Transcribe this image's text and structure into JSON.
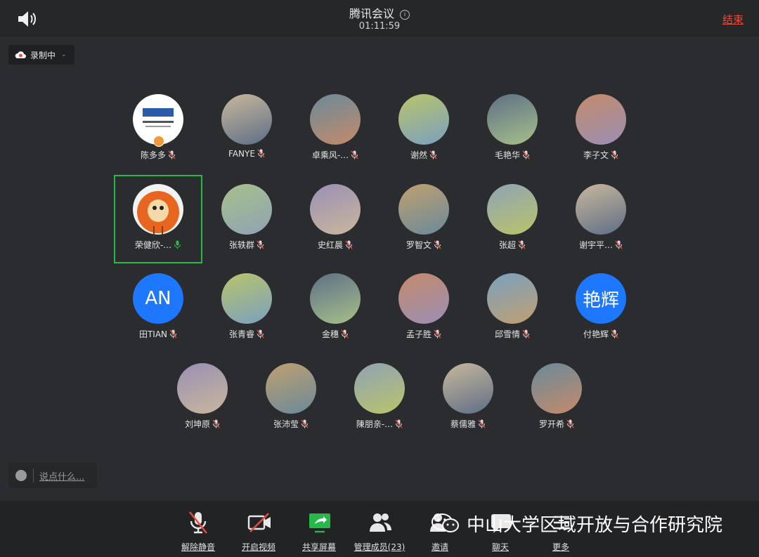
{
  "header": {
    "title": "腾讯会议",
    "info_glyph": "i",
    "timer": "01:11:59",
    "end_label": "结束"
  },
  "recording": {
    "label": "录制中",
    "chevron": "⌄"
  },
  "participants": [
    {
      "name": "陈多多",
      "muted": true,
      "avatar_icon": "logo-avatar",
      "host": true
    },
    {
      "name": "FANYE",
      "muted": true,
      "avatar_icon": "photo-avatar"
    },
    {
      "name": "卓乘风-…",
      "muted": true,
      "avatar_icon": "photo-avatar"
    },
    {
      "name": "谢然",
      "muted": true,
      "avatar_icon": "cartoon-avatar"
    },
    {
      "name": "毛艳华",
      "muted": true,
      "avatar_icon": "photo-avatar"
    },
    {
      "name": "李子文",
      "muted": true,
      "avatar_icon": "photo-avatar"
    },
    {
      "name": "荣健欣-…",
      "muted": false,
      "speaking": true,
      "avatar_icon": "cartoon-avatar"
    },
    {
      "name": "张轶群",
      "muted": true,
      "avatar_icon": "photo-avatar"
    },
    {
      "name": "史红晨",
      "muted": true,
      "avatar_icon": "photo-avatar"
    },
    {
      "name": "罗智文",
      "muted": true,
      "avatar_icon": "photo-avatar"
    },
    {
      "name": "张超",
      "muted": true,
      "avatar_icon": "cartoon-avatar"
    },
    {
      "name": "谢宇平…",
      "muted": true,
      "avatar_icon": "photo-avatar"
    },
    {
      "name": "田TIAN",
      "muted": true,
      "avatar_text": "AN"
    },
    {
      "name": "张青睿",
      "muted": true,
      "avatar_icon": "photo-avatar"
    },
    {
      "name": "金穗",
      "muted": true,
      "avatar_icon": "drawing-avatar"
    },
    {
      "name": "孟子胜",
      "muted": true,
      "avatar_icon": "cartoon-avatar"
    },
    {
      "name": "邱雪情",
      "muted": true,
      "avatar_icon": "photo-avatar"
    },
    {
      "name": "付艳辉",
      "muted": true,
      "avatar_text": "艳辉"
    },
    {
      "name": "刘坤原",
      "muted": true,
      "avatar_icon": "photo-avatar"
    },
    {
      "name": "张沛莹",
      "muted": true,
      "avatar_icon": "photo-avatar"
    },
    {
      "name": "陳朋亲-…",
      "muted": true,
      "avatar_icon": "cartoon-avatar"
    },
    {
      "name": "蔡儒雅",
      "muted": true,
      "avatar_icon": "cartoon-avatar"
    },
    {
      "name": "罗开希",
      "muted": true,
      "avatar_icon": "cartoon-avatar"
    }
  ],
  "chat": {
    "placeholder": "说点什么..."
  },
  "toolbar": {
    "unmute": "解除静音",
    "start_video": "开启视频",
    "share_screen": "共享屏幕",
    "manage_members": "管理成员(23)",
    "invite": "邀请",
    "chat": "聊天",
    "more": "更多"
  },
  "watermark": {
    "text": "中山大学区域开放与合作研究院"
  },
  "colors": {
    "accent_green": "#27b84a",
    "end_red": "#e64a3b",
    "avatar_blue": "#1e78ff",
    "background": "#2b2c2f"
  }
}
